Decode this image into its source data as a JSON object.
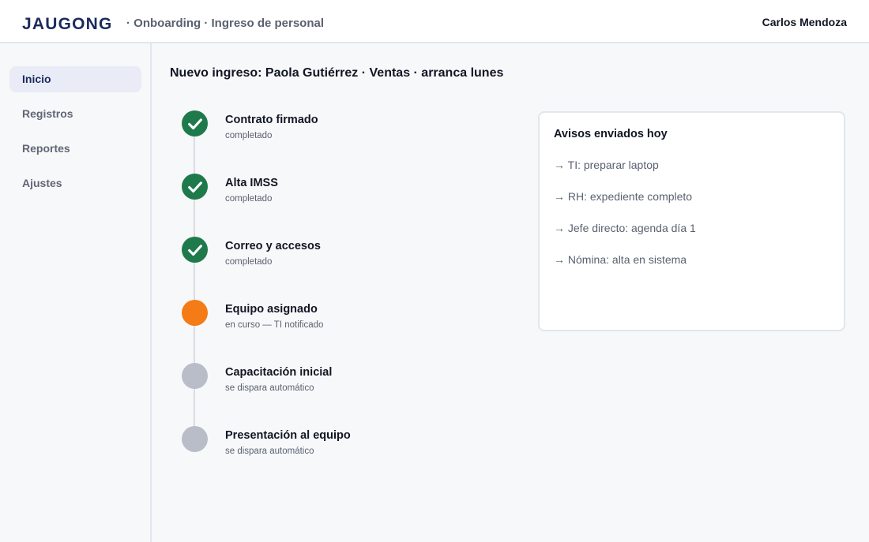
{
  "header": {
    "brand": "JAUGONG",
    "breadcrumb": "· Onboarding · Ingreso de personal",
    "user_name": "Carlos Mendoza"
  },
  "sidebar": {
    "items": [
      {
        "label": "Inicio",
        "active": true
      },
      {
        "label": "Registros",
        "active": false
      },
      {
        "label": "Reportes",
        "active": false
      },
      {
        "label": "Ajustes",
        "active": false
      }
    ]
  },
  "main": {
    "title": "Nuevo ingreso: Paola Gutiérrez · Ventas · arranca lunes",
    "steps": [
      {
        "label": "Contrato firmado",
        "status_text": "completado",
        "status": "done",
        "icon": "check-icon"
      },
      {
        "label": "Alta IMSS",
        "status_text": "completado",
        "status": "done",
        "icon": "check-icon"
      },
      {
        "label": "Correo y accesos",
        "status_text": "completado",
        "status": "done",
        "icon": "check-icon"
      },
      {
        "label": "Equipo asignado",
        "status_text": "en curso — TI notificado",
        "status": "in-progress"
      },
      {
        "label": "Capacitación inicial",
        "status_text": "se dispara automático",
        "status": "pending"
      },
      {
        "label": "Presentación al equipo",
        "status_text": "se dispara automático",
        "status": "pending"
      }
    ]
  },
  "notices": {
    "title": "Avisos enviados hoy",
    "items": [
      "→ TI: preparar laptop",
      "→ RH: expediente completo",
      "→ Jefe directo: agenda día 1",
      "→ Nómina: alta en sistema"
    ]
  },
  "colors": {
    "brand": "#1b2a5e",
    "done": "#1f7a4b",
    "in_progress": "#f47b16",
    "pending": "#b8bdc8"
  }
}
